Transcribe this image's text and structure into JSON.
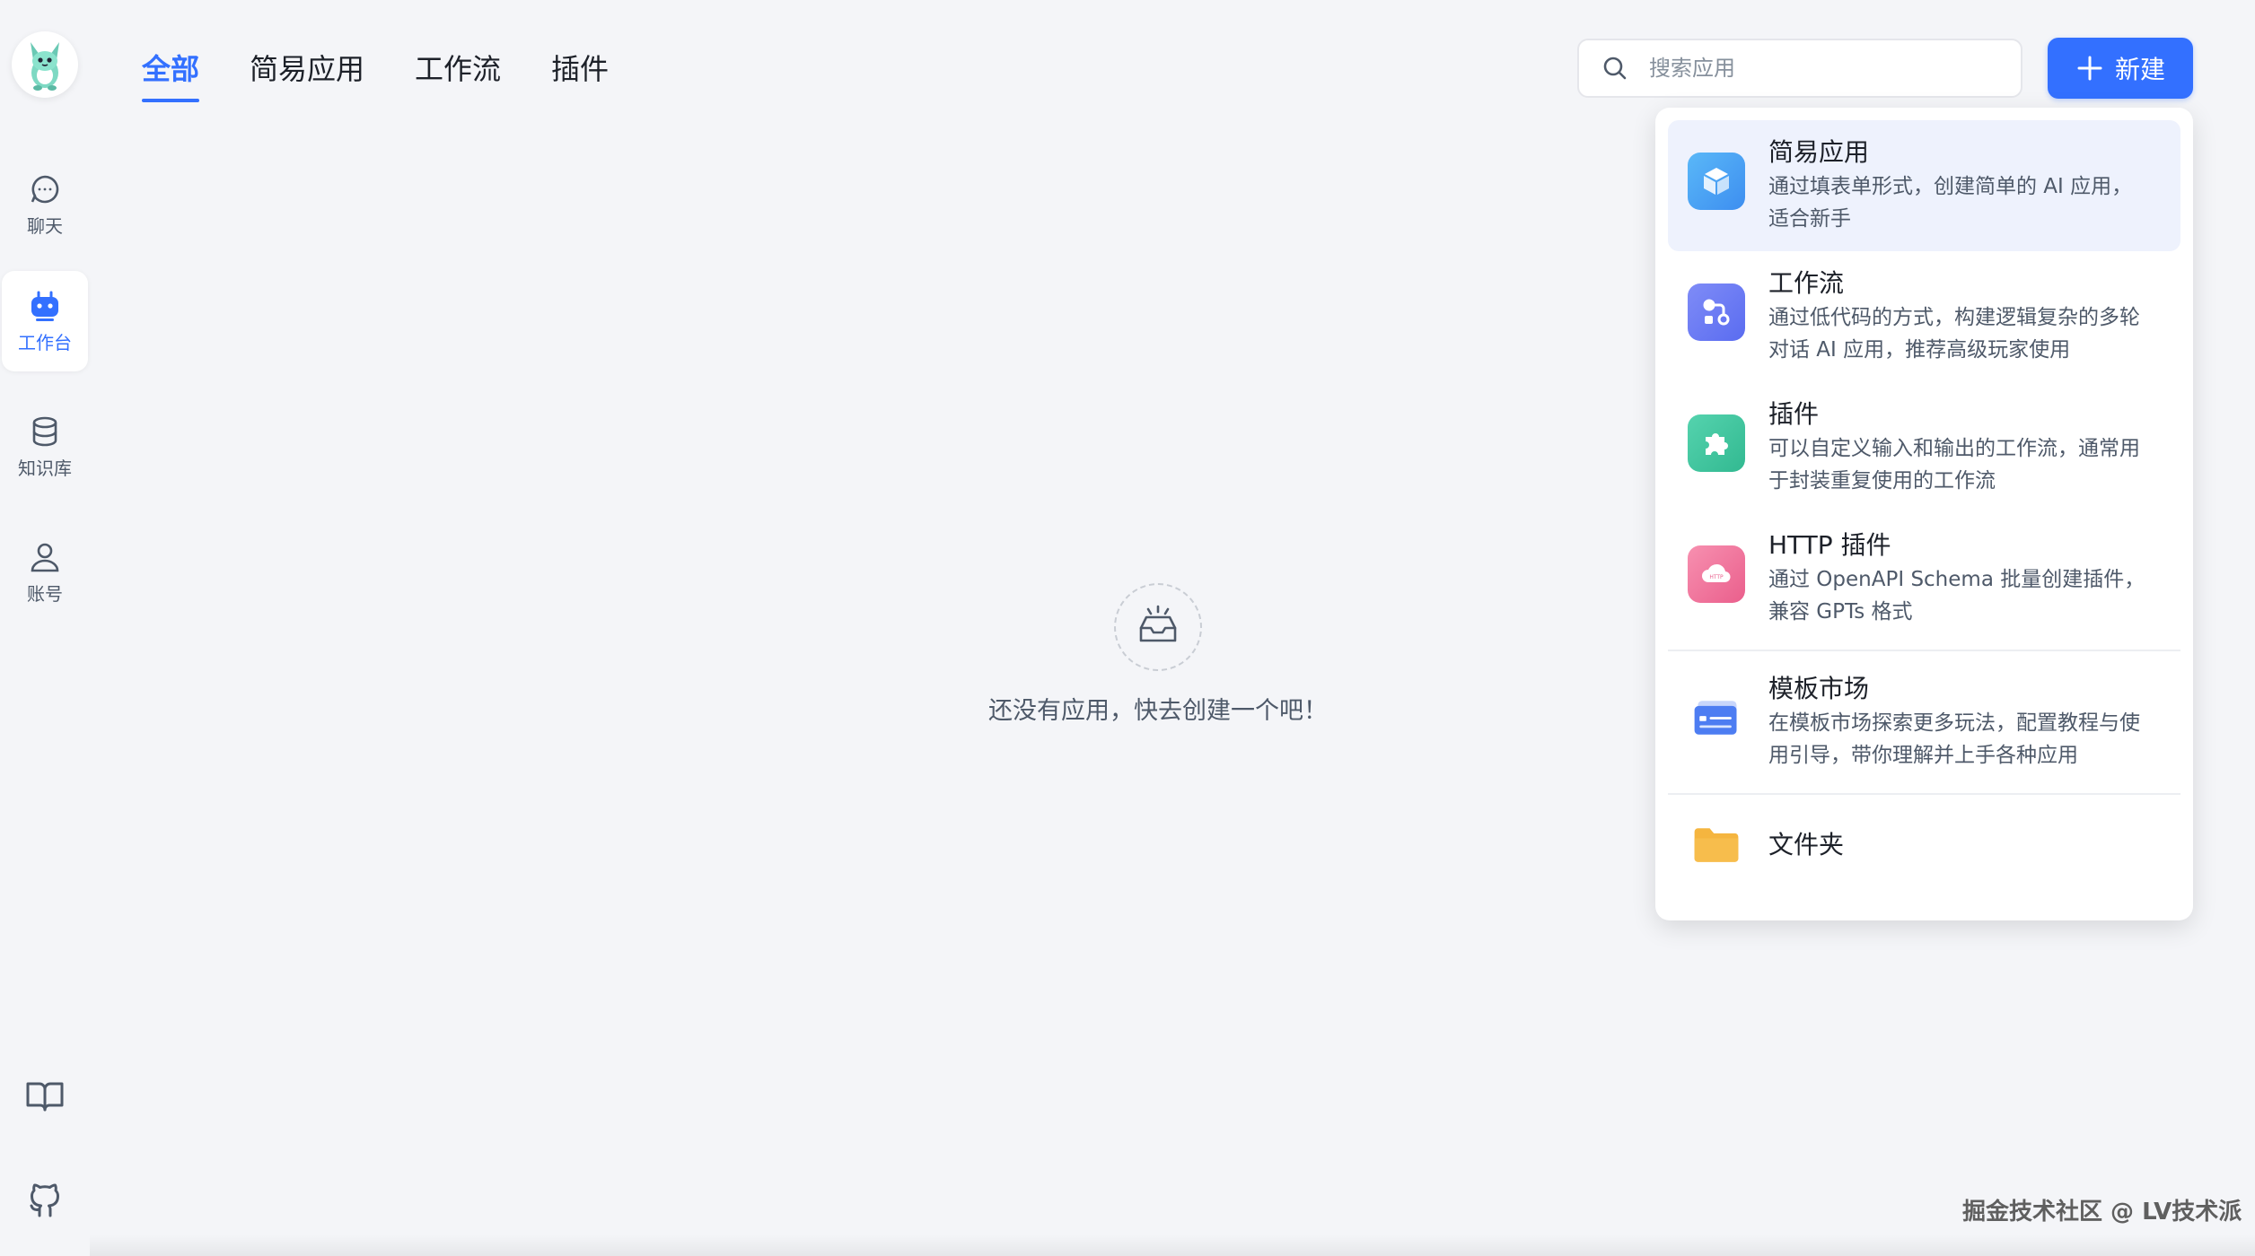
{
  "sidebar": {
    "items": [
      {
        "label": "聊天",
        "icon": "chat-icon"
      },
      {
        "label": "工作台",
        "icon": "robot-icon",
        "active": true
      },
      {
        "label": "知识库",
        "icon": "database-icon"
      },
      {
        "label": "账号",
        "icon": "user-icon"
      }
    ],
    "bottom_icons": [
      "book-icon",
      "github-icon"
    ]
  },
  "tabs": [
    {
      "label": "全部",
      "active": true
    },
    {
      "label": "简易应用"
    },
    {
      "label": "工作流"
    },
    {
      "label": "插件"
    }
  ],
  "search": {
    "placeholder": "搜索应用",
    "value": ""
  },
  "new_button": {
    "label": "新建",
    "icon": "plus-icon"
  },
  "empty_state": {
    "text": "还没有应用，快去创建一个吧！",
    "icon": "empty-inbox-icon"
  },
  "dropdown": {
    "items": [
      {
        "title": "简易应用",
        "desc_line1": "通过填表单形式，创建简单的 AI 应用，",
        "desc_line2": "适合新手",
        "icon": "cube-icon",
        "color": "#4aa3f5"
      },
      {
        "title": "工作流",
        "desc_line1": "通过低代码的方式，构建逻辑复杂的多轮",
        "desc_line2": "对话 AI 应用，推荐高级玩家使用",
        "icon": "workflow-icon",
        "color": "#6c7ef5"
      },
      {
        "title": "插件",
        "desc_line1": "可以自定义输入和输出的工作流，通常用",
        "desc_line2": "于封装重复使用的工作流",
        "icon": "puzzle-icon",
        "color": "#3fc7a1"
      },
      {
        "title": "HTTP 插件",
        "desc_line1": "通过 OpenAPI Schema 批量创建插件，",
        "desc_line2": "兼容 GPTs 格式",
        "icon": "http-cloud-icon",
        "color": "#f07aa0"
      },
      {
        "title": "模板市场",
        "desc_line1": "在模板市场探索更多玩法，配置教程与使",
        "desc_line2": "用引导，带你理解并上手各种应用",
        "icon": "template-card-icon",
        "color": "#4d7df2"
      },
      {
        "title": "文件夹",
        "icon": "folder-icon",
        "color": "#f5b53f"
      }
    ]
  },
  "watermark": "掘金技术社区 @ LV技术派",
  "colors": {
    "accent": "#3370ff",
    "background": "#f4f5f8"
  }
}
